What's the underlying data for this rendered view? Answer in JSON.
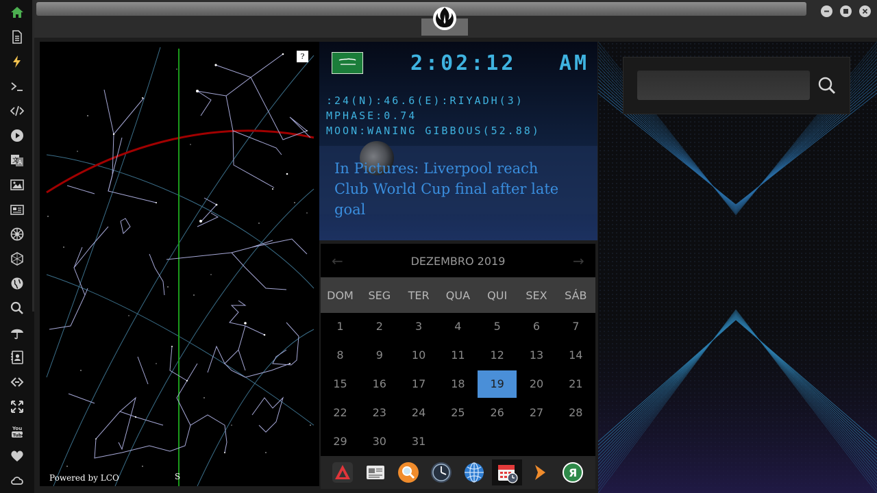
{
  "window": {
    "controls": {
      "minimize_icon": "minimize-icon",
      "maximize_icon": "maximize-icon",
      "close_icon": "close-icon"
    }
  },
  "sidebar": {
    "items": [
      {
        "name": "home",
        "icon": "home-icon",
        "color": "#4caf50"
      },
      {
        "name": "document",
        "icon": "document-icon"
      },
      {
        "name": "flash",
        "icon": "lightning-icon",
        "color": "#f2c14e"
      },
      {
        "name": "terminal",
        "icon": "terminal-icon"
      },
      {
        "name": "code",
        "icon": "code-icon"
      },
      {
        "name": "play",
        "icon": "play-icon"
      },
      {
        "name": "translate",
        "icon": "translate-icon"
      },
      {
        "name": "images",
        "icon": "image-icon"
      },
      {
        "name": "news",
        "icon": "newspaper-icon"
      },
      {
        "name": "galactic-empire",
        "icon": "empire-icon"
      },
      {
        "name": "hexagon",
        "icon": "hexagon-icon"
      },
      {
        "name": "globe",
        "icon": "globe-icon"
      },
      {
        "name": "search",
        "icon": "search-icon"
      },
      {
        "name": "weather",
        "icon": "umbrella-icon"
      },
      {
        "name": "contacts",
        "icon": "contact-icon"
      },
      {
        "name": "link",
        "icon": "link-icon"
      },
      {
        "name": "fullscreen",
        "icon": "expand-icon"
      },
      {
        "name": "youtube",
        "icon": "youtube-icon"
      },
      {
        "name": "favorites",
        "icon": "heart-icon"
      },
      {
        "name": "cloud",
        "icon": "cloud-icon"
      }
    ]
  },
  "sky": {
    "help": "?",
    "credit": "Powered by LCO",
    "compass": "S"
  },
  "clock": {
    "time": "2:02:12",
    "ampm": "AM",
    "location": ":24(N):46.6(E):RIYADH(3)",
    "moon_phase": "MPHASE:0.74",
    "moon_desc": "MOON:WANING GIBBOUS(52.88)",
    "flag_icon": "saudi-flag-icon"
  },
  "news": {
    "headline": "In Pictures: Liverpool reach Club World Cup final after late goal"
  },
  "calendar": {
    "title": "DEZEMBRO 2019",
    "prev_icon": "chevron-left-icon",
    "next_icon": "chevron-right-icon",
    "days_of_week": [
      "DOM",
      "SEG",
      "TER",
      "QUA",
      "QUI",
      "SEX",
      "SÁB"
    ],
    "weeks": [
      [
        "1",
        "2",
        "3",
        "4",
        "5",
        "6",
        "7"
      ],
      [
        "8",
        "9",
        "10",
        "11",
        "12",
        "13",
        "14"
      ],
      [
        "15",
        "16",
        "17",
        "18",
        "19",
        "20",
        "21"
      ],
      [
        "22",
        "23",
        "24",
        "25",
        "26",
        "27",
        "28"
      ],
      [
        "29",
        "30",
        "31"
      ]
    ],
    "today": "19",
    "accent": "#4a8fd8"
  },
  "dock": {
    "items": [
      {
        "name": "app-red-triangle",
        "icon": "triangle-app-icon"
      },
      {
        "name": "app-news",
        "icon": "news-app-icon"
      },
      {
        "name": "app-search",
        "icon": "magnifier-app-icon"
      },
      {
        "name": "app-clock",
        "icon": "clock-app-icon"
      },
      {
        "name": "app-browser",
        "icon": "globe-app-icon"
      },
      {
        "name": "app-calendar",
        "icon": "calendar-app-icon",
        "active": true
      },
      {
        "name": "app-play",
        "icon": "play-app-icon"
      },
      {
        "name": "app-yandex",
        "icon": "yandex-app-icon"
      }
    ]
  },
  "search": {
    "placeholder": "",
    "value": "",
    "button_icon": "search-icon"
  }
}
